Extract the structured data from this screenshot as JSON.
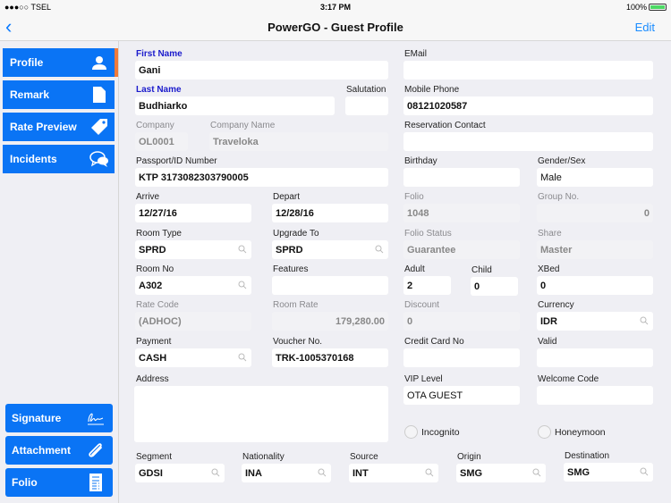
{
  "status_bar": {
    "carrier": "●●●○○ TSEL",
    "time": "3:17 PM",
    "battery": "100%",
    "battery_level": 1.0
  },
  "nav": {
    "title": "PowerGO - Guest Profile",
    "edit_label": "Edit"
  },
  "sidebar": {
    "top_items": [
      {
        "label": "Profile",
        "icon": "person-icon",
        "active": true
      },
      {
        "label": "Remark",
        "icon": "document-icon"
      },
      {
        "label": "Rate Preview",
        "icon": "tag-icon"
      },
      {
        "label": "Incidents",
        "icon": "chat-bubbles-icon"
      }
    ],
    "bottom_items": [
      {
        "label": "Signature",
        "icon": "signature-icon"
      },
      {
        "label": "Attachment",
        "icon": "paperclip-icon"
      },
      {
        "label": "Folio",
        "icon": "folio-icon"
      }
    ]
  },
  "form": {
    "first_name": {
      "label": "First Name",
      "value": "Gani"
    },
    "email": {
      "label": "EMail",
      "value": ""
    },
    "last_name": {
      "label": "Last Name",
      "value": "Budhiarko"
    },
    "salutation": {
      "label": "Salutation",
      "value": ""
    },
    "mobile_phone": {
      "label": "Mobile Phone",
      "value": "08121020587"
    },
    "company": {
      "label": "Company",
      "value": "OL0001"
    },
    "company_name": {
      "label": "Company Name",
      "value": "Traveloka"
    },
    "reservation_contact": {
      "label": "Reservation Contact",
      "value": ""
    },
    "passport": {
      "label": "Passport/ID Number",
      "value": "KTP 3173082303790005"
    },
    "birthday": {
      "label": "Birthday",
      "value": ""
    },
    "gender": {
      "label": "Gender/Sex",
      "value": "Male"
    },
    "arrive": {
      "label": "Arrive",
      "value": "12/27/16"
    },
    "depart": {
      "label": "Depart",
      "value": "12/28/16"
    },
    "folio": {
      "label": "Folio",
      "value": "1048"
    },
    "group_no": {
      "label": "Group No.",
      "value": "0"
    },
    "room_type": {
      "label": "Room Type",
      "value": "SPRD"
    },
    "upgrade_to": {
      "label": "Upgrade To",
      "value": "SPRD"
    },
    "folio_status": {
      "label": "Folio Status",
      "value": "Guarantee"
    },
    "share": {
      "label": "Share",
      "value": "Master"
    },
    "room_no": {
      "label": "Room No",
      "value": "A302"
    },
    "features": {
      "label": "Features",
      "value": ""
    },
    "adult": {
      "label": "Adult",
      "value": "2"
    },
    "child": {
      "label": "Child",
      "value": "0"
    },
    "xbed": {
      "label": "XBed",
      "value": "0"
    },
    "rate_code": {
      "label": "Rate Code",
      "value": "(ADHOC)"
    },
    "room_rate": {
      "label": "Room Rate",
      "value": "179,280.00"
    },
    "discount": {
      "label": "Discount",
      "value": "0"
    },
    "currency": {
      "label": "Currency",
      "value": "IDR"
    },
    "payment": {
      "label": "Payment",
      "value": "CASH"
    },
    "voucher_no": {
      "label": "Voucher No.",
      "value": "TRK-1005370168"
    },
    "credit_card_no": {
      "label": "Credit Card No",
      "value": ""
    },
    "valid": {
      "label": "Valid",
      "value": ""
    },
    "address": {
      "label": "Address",
      "value": ""
    },
    "vip_level": {
      "label": "VIP Level",
      "value": "OTA GUEST"
    },
    "welcome_code": {
      "label": "Welcome Code",
      "value": ""
    },
    "incognito": {
      "label": "Incognito",
      "checked": false
    },
    "honeymoon": {
      "label": "Honeymoon",
      "checked": false
    },
    "segment": {
      "label": "Segment",
      "value": "GDSI"
    },
    "nationality": {
      "label": "Nationality",
      "value": "INA"
    },
    "source": {
      "label": "Source",
      "value": "INT"
    },
    "origin": {
      "label": "Origin",
      "value": "SMG"
    },
    "destination": {
      "label": "Destination",
      "value": "SMG"
    }
  },
  "colors": {
    "accent": "#0a74f5",
    "active_marker": "#f07a3a",
    "required_label": "#1b1bcc",
    "link": "#1a8cff"
  }
}
